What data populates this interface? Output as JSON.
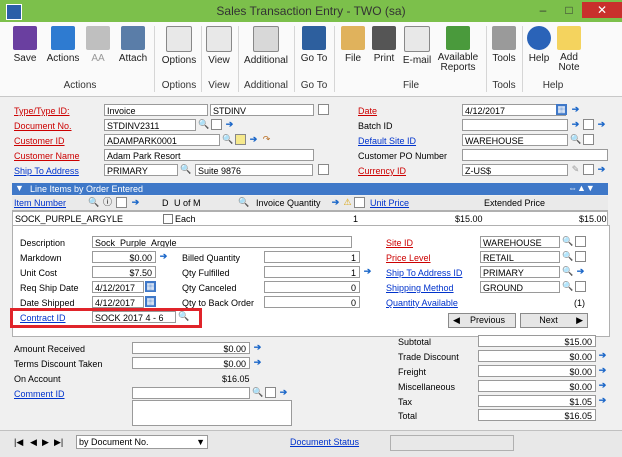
{
  "window": {
    "title": "Sales Transaction Entry  -  TWO (sa)"
  },
  "ribbon": {
    "buttons": {
      "save": "Save",
      "actions": "Actions",
      "aa": "AA",
      "attach": "Attach",
      "options": "Options",
      "view": "View",
      "additional": "Additional",
      "goto": "Go To",
      "file": "File",
      "print": "Print",
      "email": "E-mail",
      "available_reports": "Available Reports",
      "tools": "Tools",
      "help": "Help",
      "add_note": "Add Note"
    },
    "groups": {
      "actions": "Actions",
      "options": "Options",
      "view": "View",
      "additional": "Additional",
      "goto": "Go To",
      "file": "File",
      "tools": "Tools",
      "help": "Help"
    }
  },
  "header": {
    "type_label": "Type/Type ID:",
    "type_value": "Invoice",
    "type_id": "STDINV",
    "docno_label": "Document No.",
    "docno_value": "STDINV2311",
    "custid_label": "Customer ID",
    "custid_value": "ADAMPARK0001",
    "custname_label": "Customer Name",
    "custname_value": "Adam Park Resort",
    "shipto_label": "Ship To Address",
    "shipto_value": "PRIMARY",
    "shipto_desc": "Suite 9876",
    "date_label": "Date",
    "date_value": "4/12/2017",
    "batch_label": "Batch ID",
    "batch_value": "",
    "site_label": "Default Site ID",
    "site_value": "WAREHOUSE",
    "po_label": "Customer PO Number",
    "po_value": "",
    "currency_label": "Currency ID",
    "currency_value": "Z-US$"
  },
  "lines": {
    "title": "Line Items by Order Entered",
    "columns": {
      "item": "Item Number",
      "d": "D",
      "uom": "U of M",
      "qty": "Invoice Quantity",
      "unit_price": "Unit Price",
      "ext_price": "Extended Price"
    },
    "row": {
      "item": "SOCK_PURPLE_ARGYLE",
      "uom": "Each",
      "qty": "1",
      "unit_price": "$15.00",
      "ext_price": "$15.00"
    }
  },
  "detail": {
    "desc_label": "Description",
    "desc_value": "Sock_Purple_Argyle",
    "markdown_label": "Markdown",
    "markdown_value": "$0.00",
    "unitcost_label": "Unit Cost",
    "unitcost_value": "$7.50",
    "reqship_label": "Req Ship Date",
    "reqship_value": "4/12/2017",
    "dateship_label": "Date Shipped",
    "dateship_value": "4/12/2017",
    "contract_label": "Contract ID",
    "contract_value": "SOCK 2017 4 - 6",
    "billed_label": "Billed Quantity",
    "billed_value": "1",
    "fulfilled_label": "Qty Fulfilled",
    "fulfilled_value": "1",
    "canceled_label": "Qty Canceled",
    "canceled_value": "0",
    "backorder_label": "Qty to Back Order",
    "backorder_value": "0",
    "siteid_label": "Site ID",
    "siteid_value": "WAREHOUSE",
    "price_label": "Price Level",
    "price_value": "RETAIL",
    "shiptoid_label": "Ship To Address ID",
    "shiptoid_value": "PRIMARY",
    "shipmethod_label": "Shipping Method",
    "shipmethod_value": "GROUND",
    "qtyavail_label": "Quantity Available",
    "qtyavail_value": "(1)",
    "previous": "Previous",
    "next": "Next"
  },
  "payment": {
    "received_label": "Amount Received",
    "received_value": "$0.00",
    "terms_label": "Terms Discount Taken",
    "terms_value": "$0.00",
    "onaccount_label": "On Account",
    "onaccount_value": "$16.05",
    "comment_label": "Comment ID",
    "comment_value": ""
  },
  "totals": {
    "subtotal_label": "Subtotal",
    "subtotal_value": "$15.00",
    "tradediscount_label": "Trade Discount",
    "tradediscount_value": "$0.00",
    "freight_label": "Freight",
    "freight_value": "$0.00",
    "misc_label": "Miscellaneous",
    "misc_value": "$0.00",
    "tax_label": "Tax",
    "tax_value": "$1.05",
    "total_label": "Total",
    "total_value": "$16.05"
  },
  "footer": {
    "sort": "by Document No.",
    "status": "Document Status"
  }
}
